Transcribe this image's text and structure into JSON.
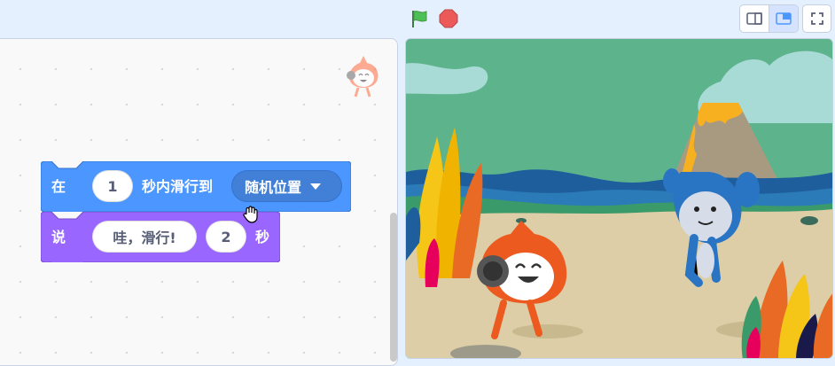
{
  "controls": {
    "green_flag_icon": "green-flag",
    "stop_icon": "stop-sign",
    "small_stage_icon": "small-stage-layout",
    "normal_stage_icon": "normal-stage-layout",
    "fullscreen_icon": "fullscreen"
  },
  "blocks": {
    "motion": {
      "prefix": "在",
      "seconds": "1",
      "middle": "秒内滑行到",
      "target": "随机位置",
      "color": "#4c97ff"
    },
    "looks": {
      "prefix": "说",
      "message": "哇，滑行!",
      "seconds": "2",
      "suffix": "秒",
      "color": "#9966ff"
    }
  },
  "colors": {
    "accent": "#4c97ff",
    "looks": "#9966ff",
    "background": "#e5f0ff"
  }
}
